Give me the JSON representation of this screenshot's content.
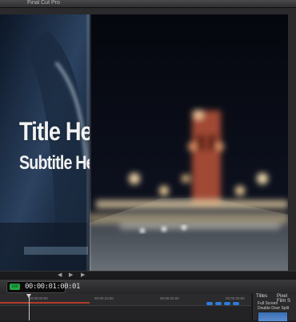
{
  "app": {
    "title": "Final Cut Pro"
  },
  "viewer": {
    "title_text": "Title Her",
    "subtitle_text": "Subtitle He"
  },
  "transport": {
    "prev": "◀",
    "play": "▶",
    "next": "▶"
  },
  "toolbar": {
    "timecode": "00:00:01:00:01",
    "badge": "100"
  },
  "timeline": {
    "ticks": [
      "00:00:00:00",
      "00:00:10:00",
      "00:00:20:00",
      "00:00:30:00"
    ]
  },
  "browser": {
    "tab_titles": "Titles",
    "tab_pixel": "Pixel Film S",
    "item_label": "Full Screen Double Door Split"
  }
}
